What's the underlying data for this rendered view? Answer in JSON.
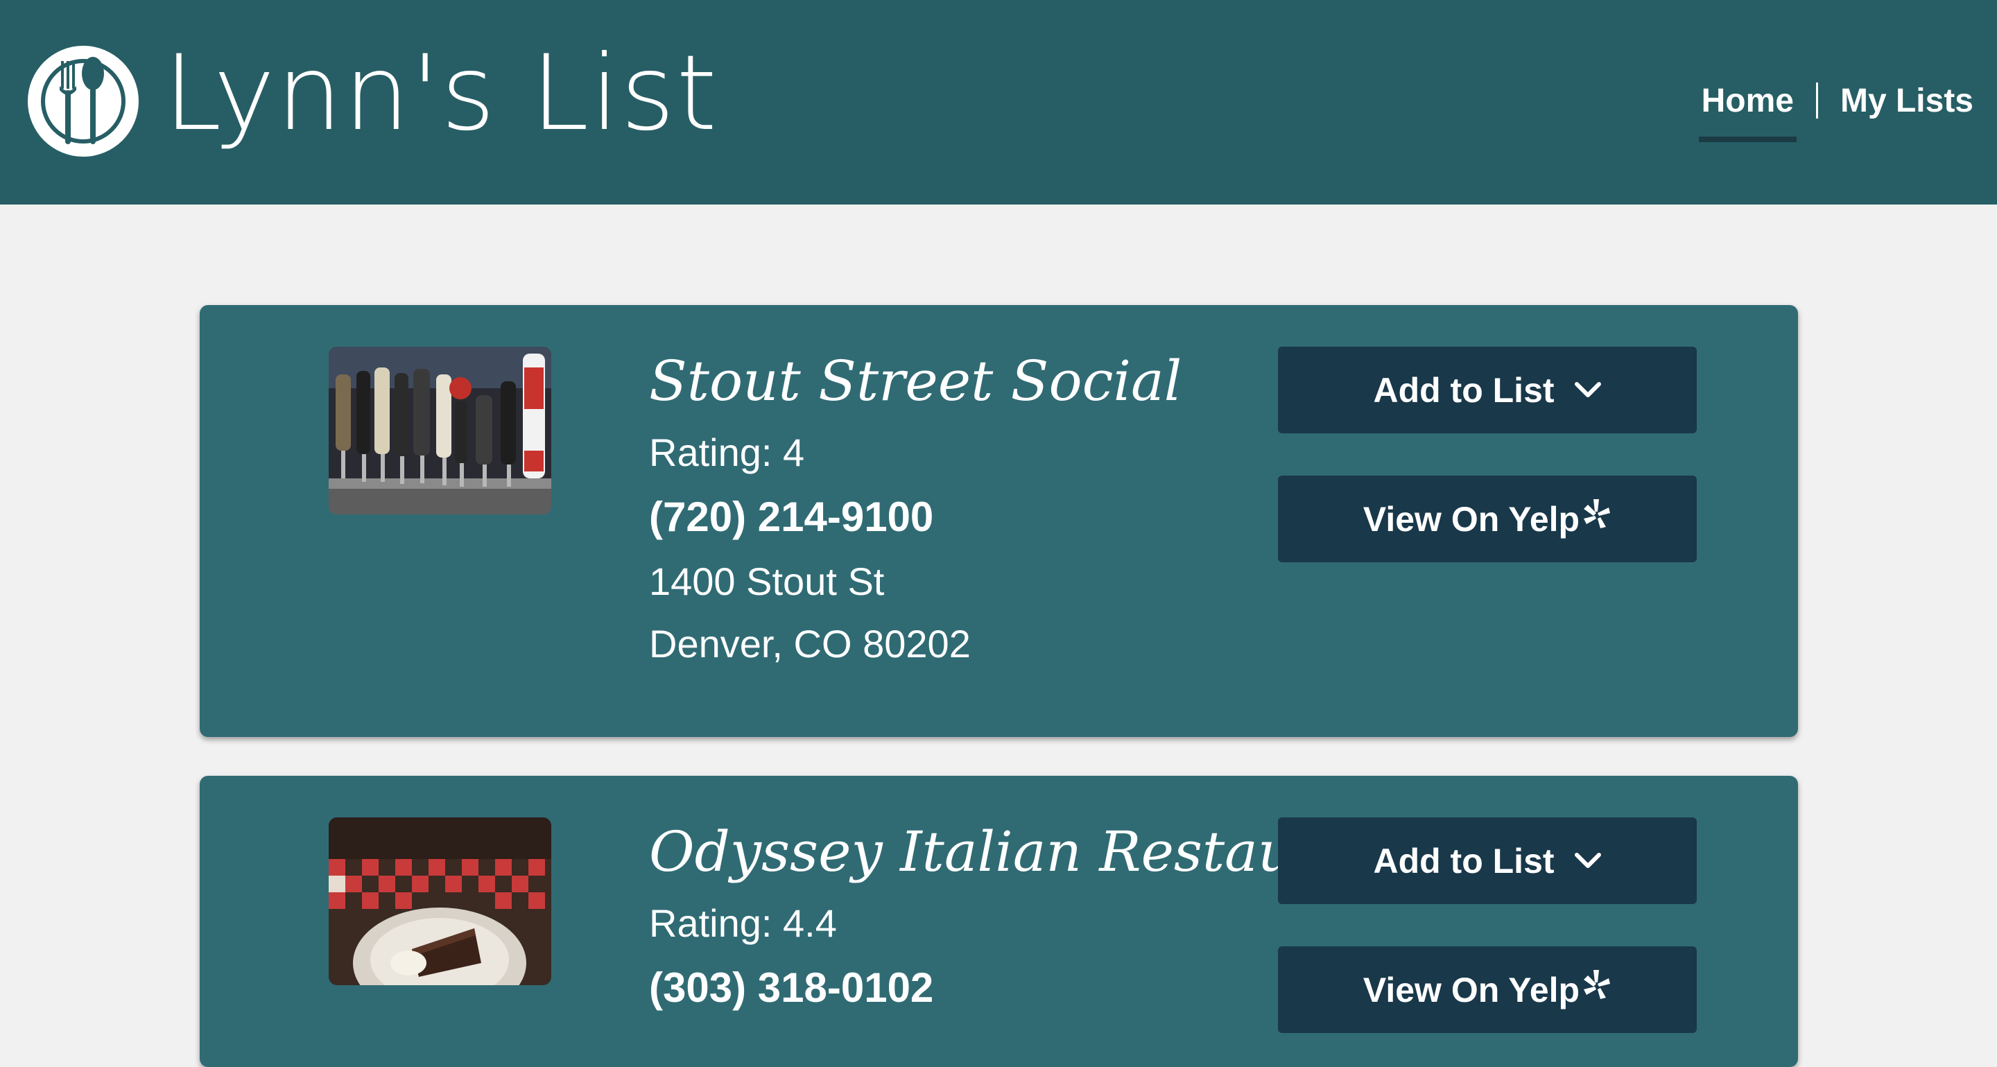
{
  "brand": {
    "name": "Lynn's List",
    "logo_icon": "fork-spoon-plate-icon"
  },
  "nav": {
    "home": "Home",
    "my_lists": "My Lists"
  },
  "colors": {
    "header_bg": "#275e65",
    "card_bg": "#306b74",
    "button_bg": "#19384a",
    "page_bg": "#f1f1f2"
  },
  "results": [
    {
      "name": "Stout Street Social",
      "rating": "Rating: 4",
      "phone": "(720) 214-9100",
      "address_line1": "1400 Stout St",
      "address_line2": "Denver, CO 80202",
      "add_label": "Add to List",
      "yelp_label": "View On Yelp"
    },
    {
      "name": "Odyssey Italian Restaurant",
      "rating": "Rating: 4.4",
      "phone": "(303) 318-0102",
      "add_label": "Add to List",
      "yelp_label": "View On Yelp"
    }
  ]
}
